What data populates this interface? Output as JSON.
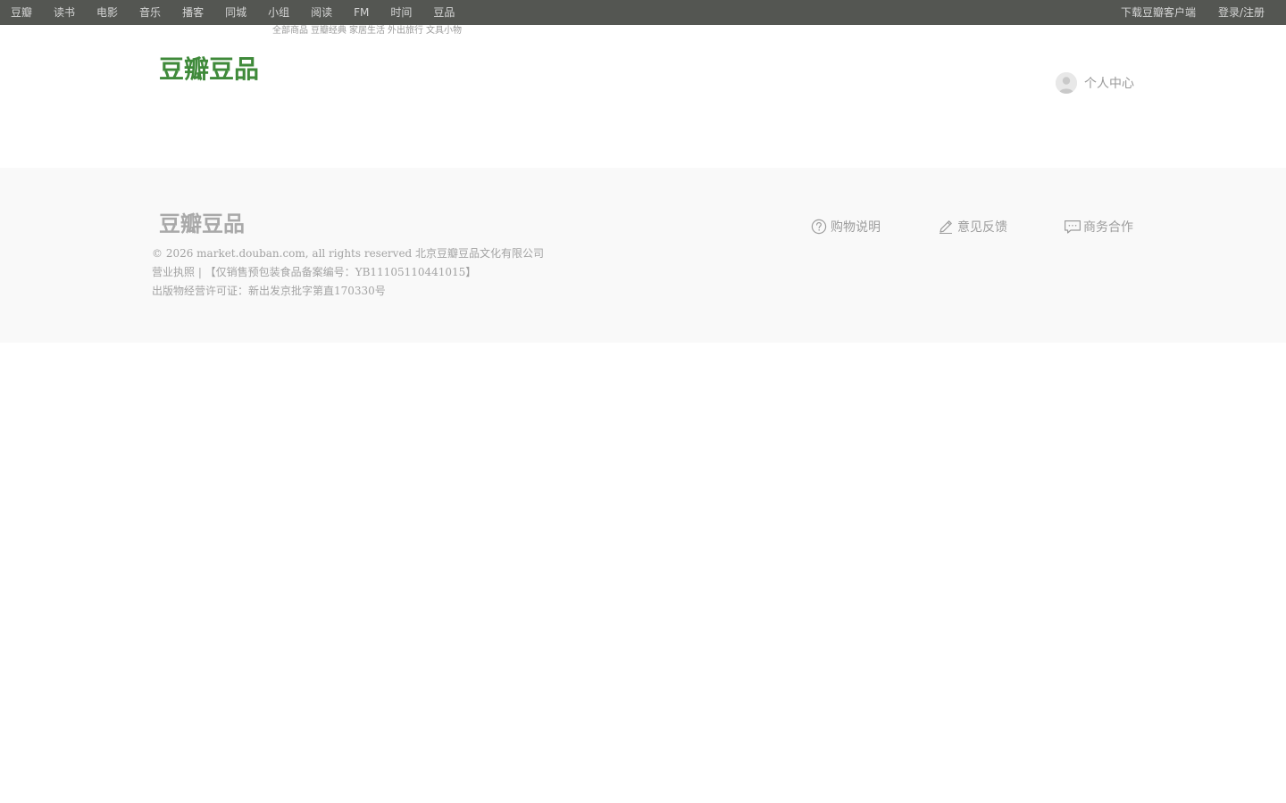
{
  "topbar": {
    "left_items": [
      "豆瓣",
      "读书",
      "电影",
      "音乐",
      "播客",
      "同城",
      "小组",
      "阅读",
      "FM",
      "时间",
      "豆品"
    ],
    "right_items": [
      "下载豆瓣客户端",
      "登录/注册"
    ]
  },
  "subnav": {
    "items": [
      "全部商品",
      "豆瓣经典",
      "家居生活",
      "外出旅行",
      "文具小物"
    ]
  },
  "header": {
    "logo_text": "豆瓣豆品",
    "user_center_label": "个人中心"
  },
  "footer": {
    "logo_text": "豆瓣豆品",
    "copyright": "© 2026 market.douban.com, all rights reserved 北京豆瓣豆品文化有限公司",
    "license_line": "营业执照 | 【仅销售预包装食品备案编号：YB11105110441015】",
    "publish_line": "出版物经营许可证：新出发京批字第直170330号",
    "links": {
      "shopping_help": "购物说明",
      "feedback": "意见反馈",
      "business": "商务合作"
    }
  },
  "colors": {
    "topbar_bg": "#545652",
    "logo_green": "#3f8a3a",
    "footer_bg": "#f9f9f9"
  }
}
